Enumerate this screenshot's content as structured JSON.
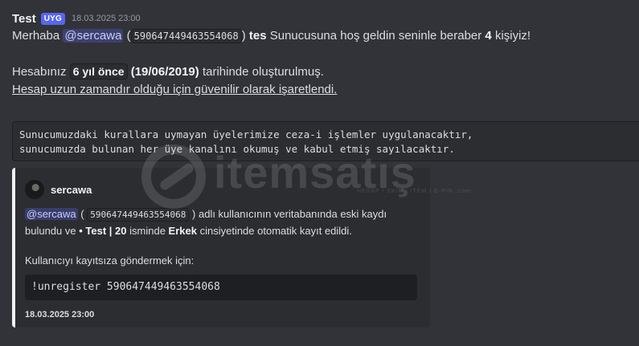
{
  "message": {
    "author": "Test",
    "badge": "UYG",
    "timestamp": "18.03.2025 23:00",
    "line1": {
      "prefix": "Merhaba",
      "mention": "@sercawa",
      "open_paren": "(",
      "user_id": "590647449463554068",
      "close_paren": ")",
      "server_name": "tes",
      "middle": "Sunucusuna hoş geldin seninle beraber",
      "member_count": "4",
      "suffix": "kişiyiz!"
    },
    "line2": {
      "prefix": "Hesabınız",
      "age": "6 yıl önce",
      "date": "(19/06/2019)",
      "suffix": "tarihinde oluşturulmuş."
    },
    "line3": "Hesap uzun zamandır olduğu için güvenilir olarak işaretlendi.",
    "code_block": [
      "Sunucumuzdaki kurallara uymayan üyelerimize ceza-i işlemler uygulanacaktır,",
      "sunucumuzda bulunan her üye kanalını okumuş ve kabul etmiş sayılacaktır."
    ]
  },
  "embed": {
    "author_name": "sercawa",
    "desc": {
      "mention": "@sercawa",
      "open_paren": "(",
      "user_id": "590647449463554068",
      "after_id": ") adlı kullanıcının veritabanında eski kaydı",
      "line2_a": "bulundu ve",
      "bold_name": "• Test | 20",
      "line2_b": "isminde",
      "gender": "Erkek",
      "line2_c": "cinsiyetinde otomatik kayıt edildi."
    },
    "instruction": "Kullanıcıyı kayıtsıza göndermek için:",
    "command": "!unregister 590647449463554068",
    "footer": "18.03.2025 23:00"
  },
  "watermark": {
    "text": "itemsatış",
    "sub": "HESAP / SKIN / ITEM / E-PIN .com"
  },
  "colors": {
    "background": "#313338",
    "embed_bg": "#2b2d31",
    "embed_border": "#f2f3f5",
    "badge": "#5865f2",
    "mention_bg": "#3c4270"
  }
}
